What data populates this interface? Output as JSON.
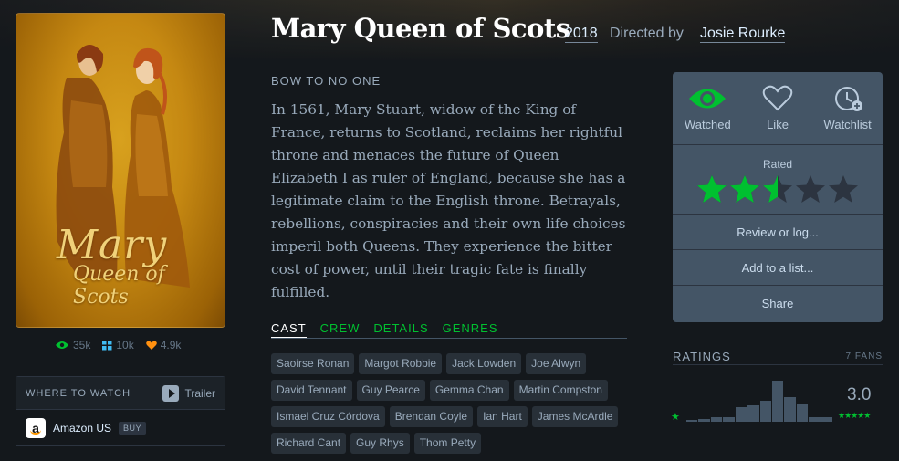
{
  "film": {
    "title": "Mary Queen of Scots",
    "year": "2018",
    "directed_by_label": "Directed by",
    "director": "Josie Rourke",
    "tagline": "BOW TO NO ONE",
    "synopsis": "In 1561, Mary Stuart, widow of the King of France, returns to Scotland, reclaims her rightful throne and menaces the future of Queen Elizabeth I as ruler of England, because she has a legitimate claim to the English throne. Betrayals, rebellions, conspiracies and their own life choices imperil both Queens. They experience the bitter cost of power, until their tragic fate is finally fulfilled."
  },
  "poster": {
    "title_line1": "Mary",
    "title_line2": "Queen of Scots"
  },
  "stats": {
    "watched": "35k",
    "lists": "10k",
    "likes": "4.9k"
  },
  "where_to_watch": {
    "title": "WHERE TO WATCH",
    "trailer_label": "Trailer",
    "services": [
      {
        "name": "Amazon US",
        "badge": "BUY",
        "logo_letter": "a"
      }
    ]
  },
  "tabs": [
    {
      "label": "CAST",
      "active": true
    },
    {
      "label": "CREW"
    },
    {
      "label": "DETAILS"
    },
    {
      "label": "GENRES"
    }
  ],
  "cast": [
    "Saoirse Ronan",
    "Margot Robbie",
    "Jack Lowden",
    "Joe Alwyn",
    "David Tennant",
    "Guy Pearce",
    "Gemma Chan",
    "Martin Compston",
    "Ismael Cruz Córdova",
    "Brendan Coyle",
    "Ian Hart",
    "James McArdle",
    "Richard Cant",
    "Guy Rhys",
    "Thom Petty"
  ],
  "actions": {
    "watched": "Watched",
    "like": "Like",
    "watchlist": "Watchlist",
    "rated_label": "Rated",
    "rating_stars": 2.5,
    "review": "Review or log...",
    "add_list": "Add to a list...",
    "share": "Share"
  },
  "ratings": {
    "title": "RATINGS",
    "fans": "7 FANS",
    "average": "3.0",
    "histogram": [
      0.04,
      0.06,
      0.1,
      0.1,
      0.35,
      0.4,
      0.5,
      1.0,
      0.6,
      0.42,
      0.1,
      0.1
    ],
    "min_label": "★",
    "max_label": "★★★★★"
  },
  "colors": {
    "accent_green": "#00c030",
    "watched_green": "#40bcf4",
    "like_orange": "#ff9010",
    "background": "#14181c",
    "panel": "#456"
  }
}
